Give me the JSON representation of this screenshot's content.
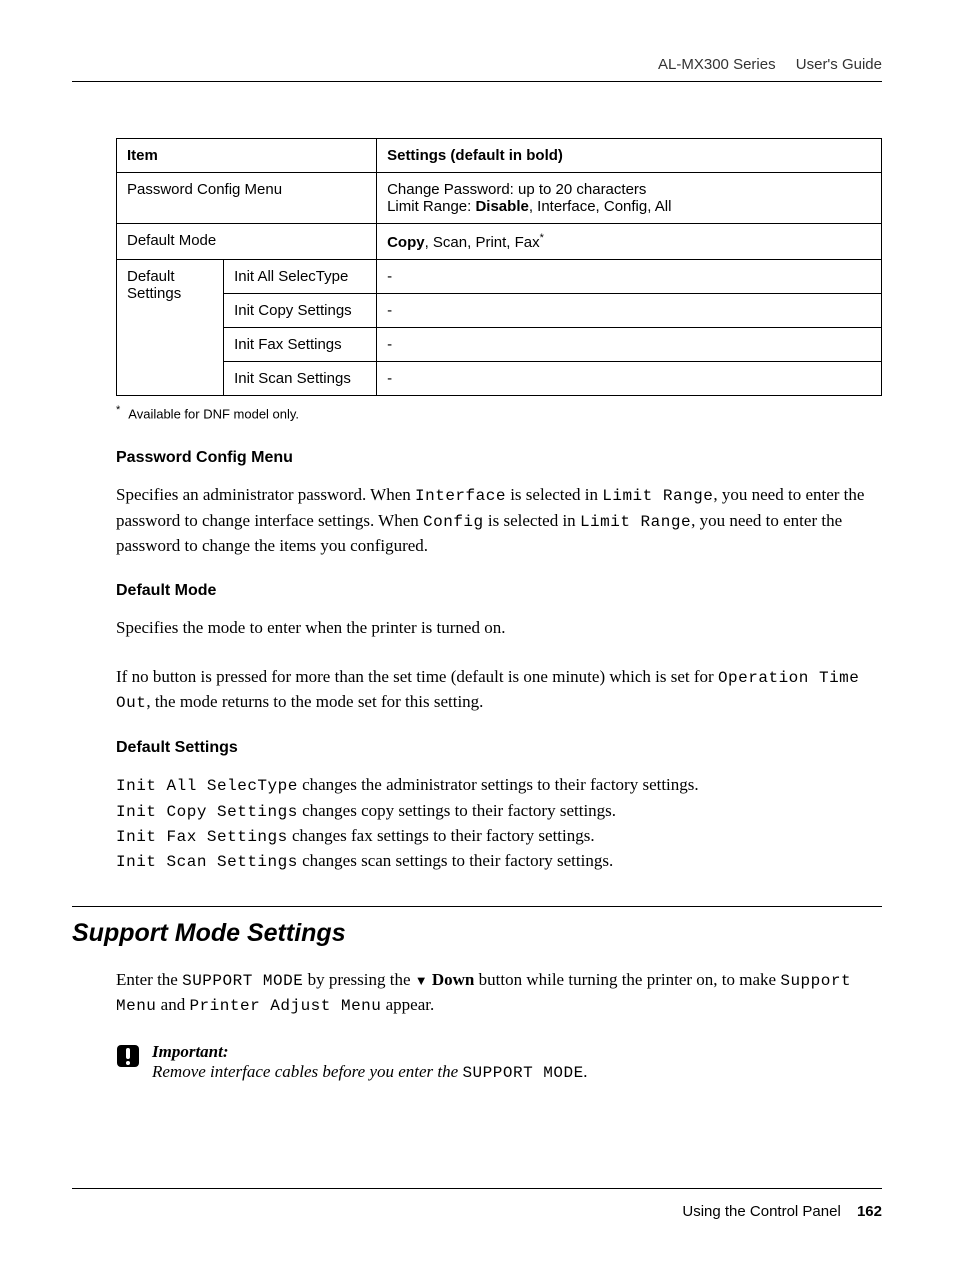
{
  "header": {
    "series": "AL-MX300 Series",
    "guide": "User's Guide"
  },
  "table": {
    "head": {
      "item": "Item",
      "settings": "Settings (default in bold)"
    },
    "rows": {
      "password_config": {
        "item": "Password Config Menu",
        "settings_line1": "Change Password: up to 20 characters",
        "settings_line2_pre": "Limit Range: ",
        "settings_line2_bold": "Disable",
        "settings_line2_post": ", Interface, Config, All"
      },
      "default_mode": {
        "item": "Default Mode",
        "settings_bold": "Copy",
        "settings_post": ", Scan, Print, Fax",
        "settings_sup": "*"
      },
      "default_settings": {
        "item": "Default Settings",
        "sub1": "Init All SelecType",
        "val1": "-",
        "sub2": "Init Copy Settings",
        "val2": "-",
        "sub3": "Init Fax Settings",
        "val3": "-",
        "sub4": "Init Scan Settings",
        "val4": "-"
      }
    }
  },
  "footnote": {
    "marker": "*",
    "text": "Available for DNF model only."
  },
  "sections": {
    "pcm": {
      "heading": "Password Config Menu",
      "p1_pre": "Specifies an administrator password. When ",
      "p1_c1": "Interface",
      "p1_mid1": " is selected in ",
      "p1_c2": "Limit Range",
      "p1_mid2": ", you need to enter the password to change interface settings. When ",
      "p1_c3": "Config",
      "p1_mid3": " is selected in ",
      "p1_c4": "Limit Range",
      "p1_post": ", you need to enter the password to change the items you configured."
    },
    "dm": {
      "heading": "Default Mode",
      "p1": "Specifies the mode to enter when the printer is turned on.",
      "p2_pre": "If no button is pressed for more than the set time (default is one minute) which is set for ",
      "p2_c1": "Operation Time Out",
      "p2_post": ", the mode returns to the mode set for this setting."
    },
    "ds": {
      "heading": "Default Settings",
      "l1_c": "Init All SelecType",
      "l1_t": " changes the administrator settings to their factory settings.",
      "l2_c": "Init Copy Settings",
      "l2_t": " changes copy settings to their factory settings.",
      "l3_c": "Init Fax Settings",
      "l3_t": " changes fax settings to their factory settings.",
      "l4_c": "Init Scan Settings",
      "l4_t": " changes scan settings to their factory settings."
    }
  },
  "support": {
    "heading": "Support Mode Settings",
    "p_pre": "Enter the ",
    "p_c1": "SUPPORT MODE",
    "p_mid1": " by pressing the ",
    "p_down": "▼ Down",
    "p_mid2": " button while turning the printer on, to make ",
    "p_c2": "Support Menu",
    "p_mid3": " and ",
    "p_c3": "Printer Adjust Menu",
    "p_post": " appear."
  },
  "important": {
    "label": "Important:",
    "msg_pre": "Remove interface cables before you enter the ",
    "msg_code": "SUPPORT MODE",
    "msg_post": "."
  },
  "footer": {
    "section": "Using the Control Panel",
    "page": "162"
  }
}
